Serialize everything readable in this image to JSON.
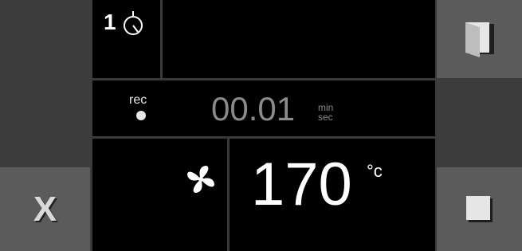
{
  "step": {
    "number": "1"
  },
  "recording": {
    "label": "rec"
  },
  "timer": {
    "value": "00.01",
    "unit_top": "min",
    "unit_bottom": "sec"
  },
  "temperature": {
    "value": "170",
    "unit": "°c"
  },
  "buttons": {
    "cancel_label": "X"
  },
  "colors": {
    "background": "#3a3a3a",
    "panel": "#000000",
    "button": "#5b5b5b",
    "timer_text": "#8a8a8a",
    "icon": "#d9d9d9"
  },
  "icons": {
    "step_timer": "timer-icon",
    "door": "door-icon",
    "stop": "stop-icon",
    "fan": "fan-icon",
    "rec_dot": "record-dot-icon"
  }
}
